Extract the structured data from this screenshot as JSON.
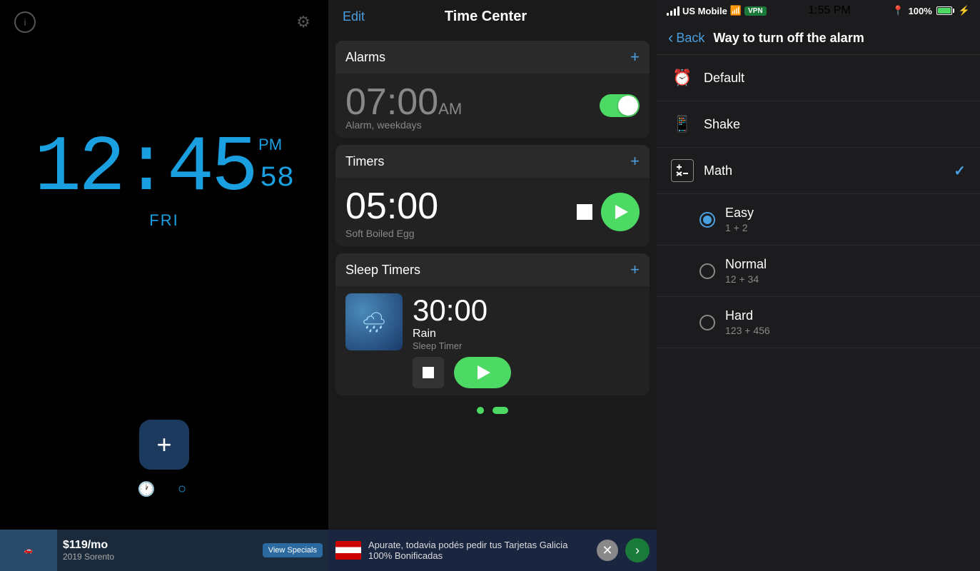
{
  "left": {
    "info_label": "i",
    "settings_label": "⚙",
    "time": "12:45",
    "seconds": "58",
    "ampm": "PM",
    "day": "FRI",
    "add_label": "+",
    "nav_icons": [
      "clock",
      "circle"
    ],
    "ad": {
      "price": "$119/mo",
      "cta": "View Specials",
      "car": "2019 Sorento"
    }
  },
  "middle": {
    "edit_label": "Edit",
    "title": "Time Center",
    "sections": {
      "alarms": {
        "title": "Alarms",
        "alarm_time": "07:00",
        "alarm_ampm": "AM",
        "alarm_label": "Alarm, weekdays"
      },
      "timers": {
        "title": "Timers",
        "timer_time": "05:00",
        "timer_label": "Soft Boiled Egg"
      },
      "sleep_timers": {
        "title": "Sleep Timers",
        "sleep_time": "30:00",
        "sleep_name": "Rain",
        "sleep_type": "Sleep Timer"
      }
    },
    "ad": {
      "text": "Apurate, todavia podés pedir tus Tarjetas Galicia 100% Bonificadas"
    }
  },
  "right": {
    "status": {
      "carrier": "US Mobile",
      "time": "1:55 PM",
      "battery": "100%",
      "vpn": "VPN"
    },
    "nav": {
      "back_label": "Back",
      "title": "Way to turn off the alarm"
    },
    "options": [
      {
        "icon": "⏰",
        "title": "Default",
        "subtitle": "",
        "type": "none"
      },
      {
        "icon": "📱",
        "title": "Shake",
        "subtitle": "",
        "type": "none"
      },
      {
        "icon": "±",
        "title": "Math",
        "subtitle": "",
        "type": "check",
        "checked": true
      },
      {
        "icon": "○",
        "title": "Easy",
        "subtitle": "1 + 2",
        "type": "radio",
        "checked": true
      },
      {
        "icon": "○",
        "title": "Normal",
        "subtitle": "12 + 34",
        "type": "radio",
        "checked": false
      },
      {
        "icon": "○",
        "title": "Hard",
        "subtitle": "123 + 456",
        "type": "radio",
        "checked": false
      }
    ]
  }
}
